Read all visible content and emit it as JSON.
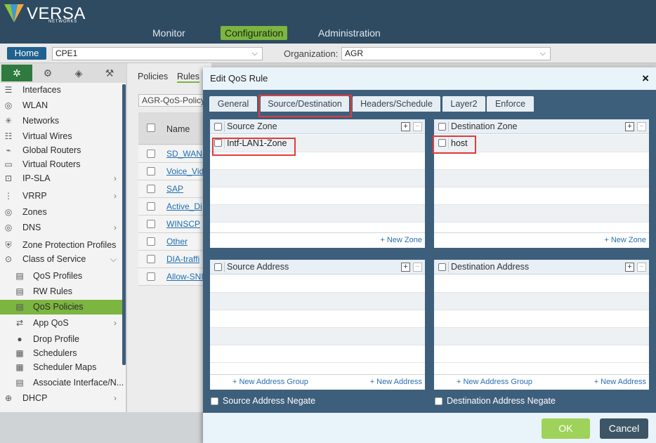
{
  "brand": {
    "name": "VERSA",
    "sub": "NETWORKS"
  },
  "topnav": {
    "monitor": "Monitor",
    "configuration": "Configuration",
    "administration": "Administration"
  },
  "subbar": {
    "home": "Home",
    "appliance": "CPE1",
    "org_label": "Organization:",
    "org": "AGR"
  },
  "sidebar": {
    "items": [
      {
        "icon": "☰",
        "label": "Interfaces"
      },
      {
        "icon": "◎",
        "label": "WLAN"
      },
      {
        "icon": "✳",
        "label": "Networks"
      },
      {
        "icon": "☷",
        "label": "Virtual Wires"
      },
      {
        "icon": "⌁",
        "label": "Global Routers"
      },
      {
        "icon": "▭",
        "label": "Virtual Routers"
      },
      {
        "icon": "⊡",
        "label": "IP-SLA"
      },
      {
        "icon": "⋮",
        "label": "VRRP"
      },
      {
        "icon": "◎",
        "label": "Zones"
      },
      {
        "icon": "◎",
        "label": "DNS"
      },
      {
        "icon": "⛨",
        "label": "Zone Protection Profiles"
      },
      {
        "icon": "⊙",
        "label": "Class of Service"
      },
      {
        "icon": "▤",
        "label": "QoS Profiles"
      },
      {
        "icon": "▤",
        "label": "RW Rules"
      },
      {
        "icon": "▤",
        "label": "QoS Policies"
      },
      {
        "icon": "⇄",
        "label": "App QoS"
      },
      {
        "icon": "●",
        "label": "Drop Profile"
      },
      {
        "icon": "▦",
        "label": "Schedulers"
      },
      {
        "icon": "▦",
        "label": "Scheduler Maps"
      },
      {
        "icon": "▤",
        "label": "Associate Interface/N..."
      },
      {
        "icon": "⊕",
        "label": "DHCP"
      }
    ]
  },
  "content": {
    "tabs": {
      "policies": "Policies",
      "rules": "Rules"
    },
    "policy": "AGR-QoS-Policy",
    "name_header": "Name",
    "rows": [
      "SD_WAN-",
      "Voice_Vid",
      "SAP",
      "Active_Di",
      "WINSCP",
      "Other",
      "DIA-traffi",
      "Allow-SNI"
    ]
  },
  "modal": {
    "title": "Edit QoS Rule",
    "close": "×",
    "tabs": [
      "General",
      "Source/Destination",
      "Headers/Schedule",
      "Layer2",
      "Enforce"
    ],
    "source_zone": {
      "title": "Source Zone",
      "rows": [
        "Intf-LAN1-Zone"
      ],
      "new": "+ New Zone"
    },
    "destination_zone": {
      "title": "Destination Zone",
      "rows": [
        "host"
      ],
      "new": "+ New Zone"
    },
    "source_address": {
      "title": "Source Address",
      "new_group": "+ New Address Group",
      "new": "+ New Address"
    },
    "destination_address": {
      "title": "Destination Address",
      "new_group": "+ New Address Group",
      "new": "+ New Address"
    },
    "source_negate": "Source Address Negate",
    "destination_negate": "Destination Address Negate",
    "ok": "OK",
    "cancel": "Cancel"
  },
  "colors": {
    "accent_green": "#7cb540",
    "header_blue": "#2e4b62",
    "modal_bg": "#3d5f7c",
    "highlight_red": "#e23b3b"
  }
}
